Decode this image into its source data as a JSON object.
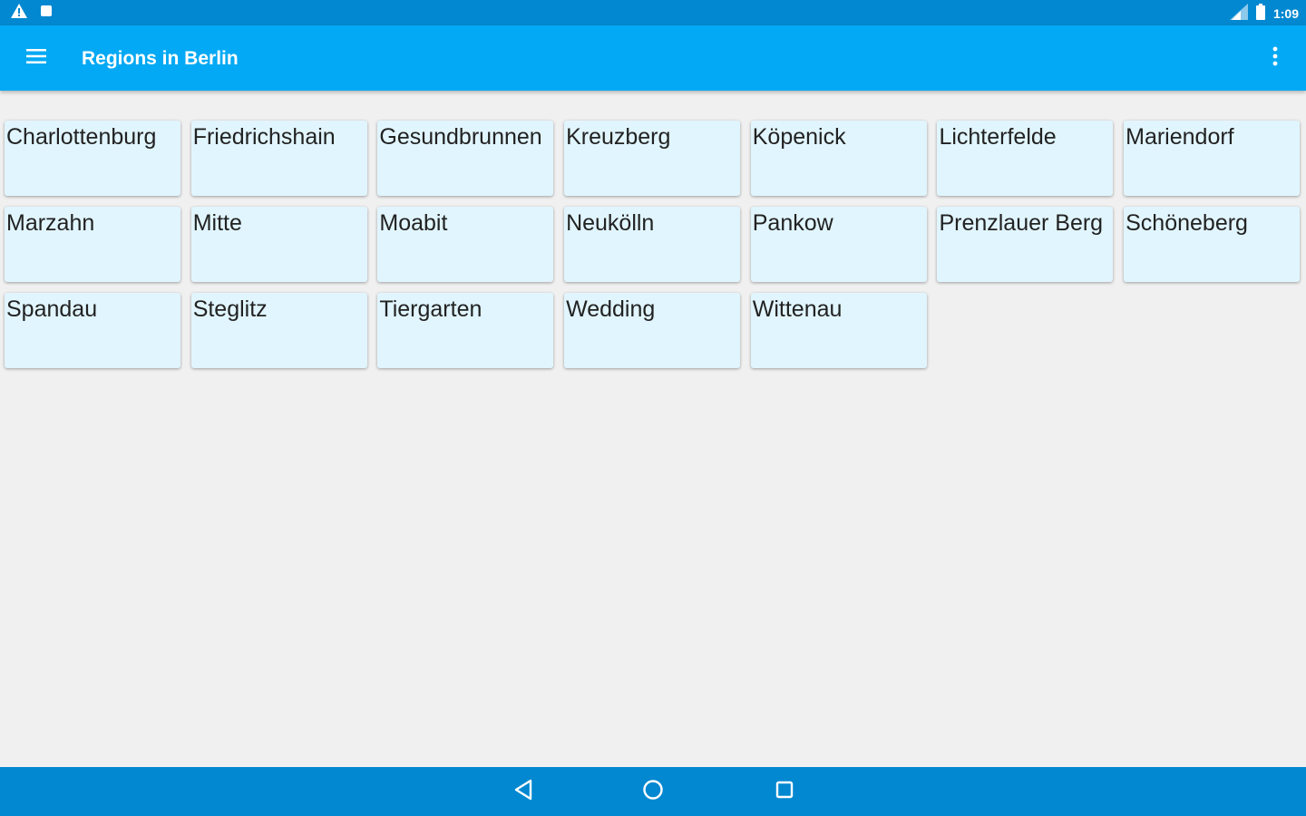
{
  "status_bar": {
    "time": "1:09",
    "icons_left": [
      "warning-icon",
      "notification-square-icon"
    ],
    "icons_right": [
      "signal-icon",
      "battery-icon"
    ]
  },
  "app_bar": {
    "title": "Regions in Berlin",
    "menu_icon": "hamburger-menu-icon",
    "overflow_icon": "more-vert-icon"
  },
  "regions": [
    "Charlottenburg",
    "Friedrichshain",
    "Gesundbrunnen",
    "Kreuzberg",
    "Köpenick",
    "Lichterfelde",
    "Mariendorf",
    "Marzahn",
    "Mitte",
    "Moabit",
    "Neukölln",
    "Pankow",
    "Prenzlauer Berg",
    "Schöneberg",
    "Spandau",
    "Steglitz",
    "Tiergarten",
    "Wedding",
    "Wittenau"
  ],
  "nav_bar": {
    "icons": [
      "back-icon",
      "home-icon",
      "recents-icon"
    ]
  },
  "colors": {
    "status_bar": "#0288d1",
    "app_bar": "#03a9f4",
    "tile": "#e1f5fe",
    "background": "#f0f0f0",
    "nav_bar": "#0288d1"
  }
}
